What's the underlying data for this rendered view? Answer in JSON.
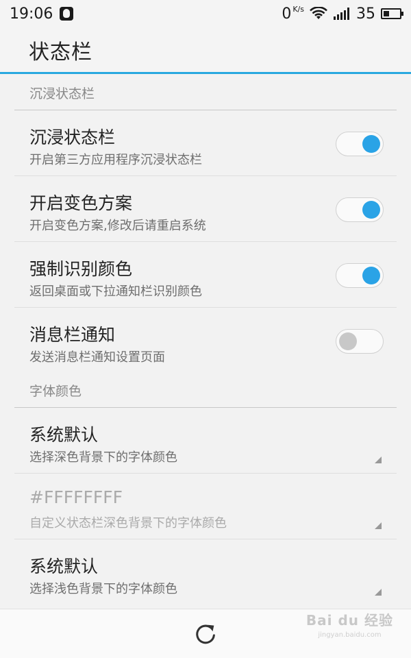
{
  "status_bar": {
    "time": "19:06",
    "speed": "0",
    "speed_unit": "K/s",
    "battery": "35"
  },
  "app_bar": {
    "title": "状态栏"
  },
  "sections": {
    "immersive": {
      "header": "沉浸状态栏",
      "rows": [
        {
          "title": "沉浸状态栏",
          "subtitle": "开启第三方应用程序沉浸状态栏",
          "enabled": true
        },
        {
          "title": "开启变色方案",
          "subtitle": "开启变色方案,修改后请重启系统",
          "enabled": true
        },
        {
          "title": "强制识别颜色",
          "subtitle": "返回桌面或下拉通知栏识别颜色",
          "enabled": true
        },
        {
          "title": "消息栏通知",
          "subtitle": "发送消息栏通知设置页面",
          "enabled": false
        }
      ]
    },
    "font_color": {
      "header": "字体颜色",
      "rows": [
        {
          "title": "系统默认",
          "subtitle": "选择深色背景下的字体颜色"
        },
        {
          "title": "#FFFFFFFF",
          "subtitle": "自定义状态栏深色背景下的字体颜色"
        },
        {
          "title": "系统默认",
          "subtitle": "选择浅色背景下的字体颜色"
        }
      ]
    }
  },
  "watermark": {
    "brand": "Bai du 经验",
    "url": "jingyan.baidu.com"
  },
  "colors": {
    "accent": "#29a8e0",
    "switch_on": "#2aa3e6",
    "switch_off": "#c8c8c8"
  }
}
